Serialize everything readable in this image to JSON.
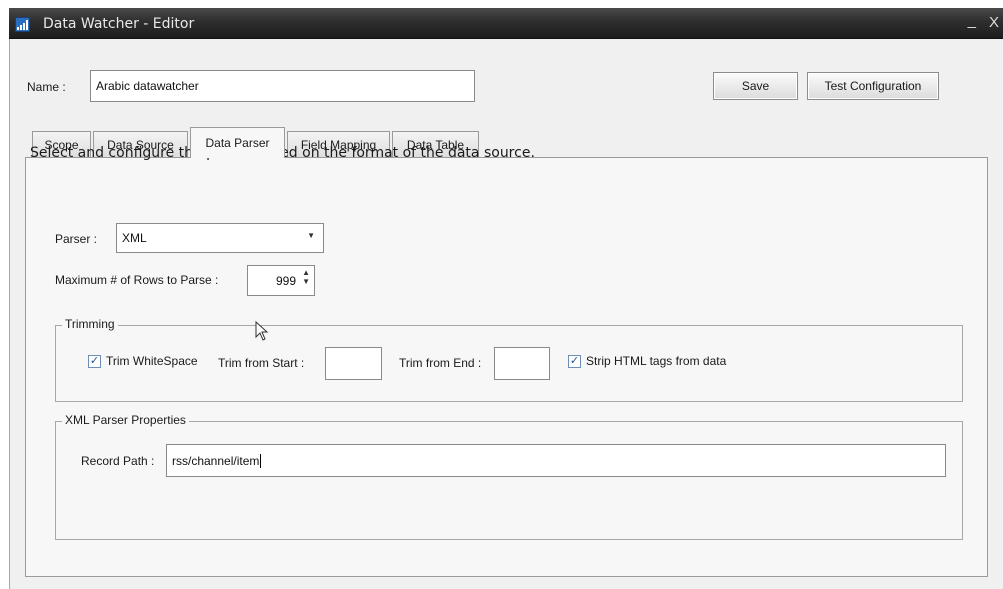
{
  "window": {
    "title": "Data Watcher - Editor",
    "minimize_glyph": "_",
    "close_glyph": "X",
    "icon": "bar-chart-icon"
  },
  "header": {
    "name_label": "Name :",
    "name_value": "Arabic datawatcher",
    "save_label": "Save",
    "test_label": "Test Configuration"
  },
  "tabs": [
    {
      "label": "Scope",
      "active": false
    },
    {
      "label": "Data Source",
      "active": false
    },
    {
      "label": "Data Parser",
      "active": true
    },
    {
      "label": "Field Mapping",
      "active": false
    },
    {
      "label": "Data Table",
      "active": false
    }
  ],
  "parser_tab": {
    "instruction": "Select and configure the parser based on the format of the data source.",
    "parser_label": "Parser :",
    "parser_value": "XML",
    "max_rows_label": "Maximum # of Rows to Parse :",
    "max_rows_value": "999",
    "trimming": {
      "title": "Trimming",
      "trim_whitespace_label": "Trim WhiteSpace",
      "trim_whitespace_checked": true,
      "trim_start_label": "Trim from Start :",
      "trim_start_value": "",
      "trim_end_label": "Trim from End :",
      "trim_end_value": "",
      "strip_html_label": "Strip HTML tags from data",
      "strip_html_checked": true
    },
    "xml_properties": {
      "title": "XML Parser Properties",
      "record_path_label": "Record Path :",
      "record_path_value": "rss/channel/item"
    }
  },
  "colors": {
    "titlebar": "#2e2e2e",
    "window_bg": "#f0f0f0",
    "panel_bg": "#f7f7f7",
    "check_mark": "#2b4f87"
  }
}
